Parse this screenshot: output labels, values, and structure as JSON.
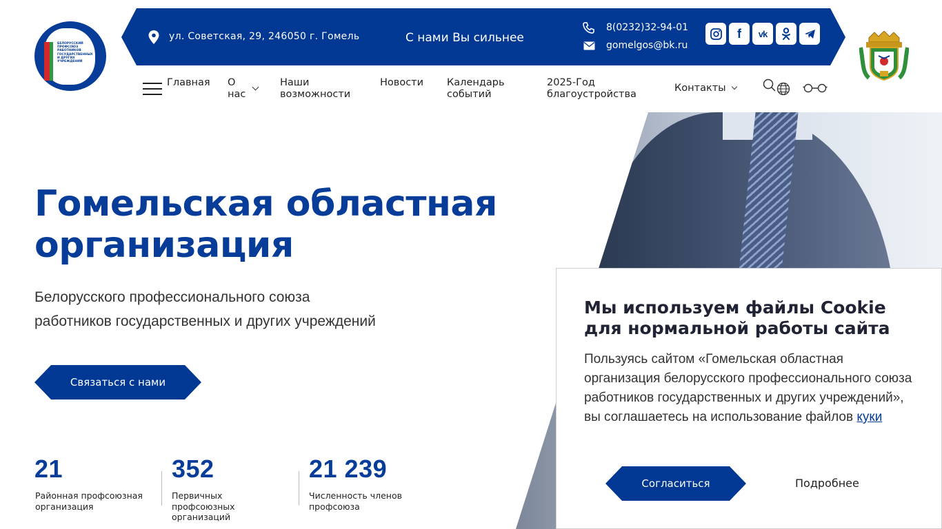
{
  "logo": {
    "text": "БЕЛОРУССКИЙ ПРОФСОЮЗ РАБОТНИКОВ ГОСУДАРСТВЕННЫХ И ДРУГИХ УЧРЕЖДЕНИЙ"
  },
  "topbar": {
    "address": "ул. Советская, 29, 246050 г. Гомель",
    "slogan": "С нами Вы сильнее",
    "phone": "8(0232)32-94-01",
    "email": "gomelgos@bk.ru",
    "social": [
      {
        "icon": "instagram-icon",
        "glyph": "◎"
      },
      {
        "icon": "facebook-icon",
        "glyph": "f"
      },
      {
        "icon": "vk-icon",
        "glyph": "vk"
      },
      {
        "icon": "odnoklassniki-icon",
        "glyph": "ok"
      },
      {
        "icon": "telegram-icon",
        "glyph": "➤"
      }
    ]
  },
  "nav": {
    "items": [
      {
        "label": "Главная"
      },
      {
        "label": "О нас"
      },
      {
        "label": "Наши возможности"
      },
      {
        "label": "Новости"
      },
      {
        "label": "Календарь событий"
      },
      {
        "label": "2025-Год благоустройства"
      },
      {
        "label": "Контакты"
      }
    ]
  },
  "hero": {
    "title": "Гомельская областная организация",
    "subtitle_line1": "Белорусского профессионального союза",
    "subtitle_line2": "работников государственных и других учреждений",
    "button": "Связаться с нами"
  },
  "stats": [
    {
      "value": "21",
      "label": "Районная профсоюзная организация"
    },
    {
      "value": "352",
      "label": "Первичных профсоюзных организаций"
    },
    {
      "value": "21 239",
      "label": "Численность членов профсоюза"
    }
  ],
  "cookie": {
    "title": "Мы используем файлы Cookie для нормальной работы сайта",
    "text": "Пользуясь сайтом «Гомельская областная организация белорусского профессионального союза работников государственных и других учреждений», вы соглашаетесь на использование файлов ",
    "link": "куки",
    "accept": "Согласиться",
    "more": "Подробнее"
  },
  "colors": {
    "brand_blue": "#003893",
    "title_blue": "#073d99"
  }
}
